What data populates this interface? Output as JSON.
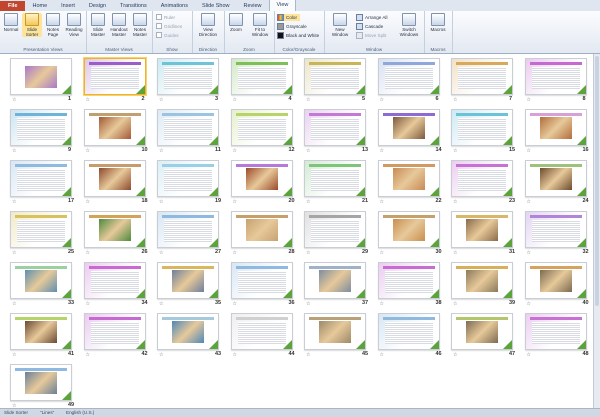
{
  "tabs": [
    "File",
    "Home",
    "Insert",
    "Design",
    "Transitions",
    "Animations",
    "Slide Show",
    "Review",
    "View"
  ],
  "ribbon": {
    "pres_views": {
      "label": "Presentation Views",
      "buttons": [
        "Normal",
        "Slide Sorter",
        "Notes Page",
        "Reading View"
      ]
    },
    "master_views": {
      "label": "Master Views",
      "buttons": [
        "Slide Master",
        "Handout Master",
        "Notes Master"
      ]
    },
    "show": {
      "label": "Show",
      "items": [
        "Ruler",
        "Gridlines",
        "Guides"
      ]
    },
    "direction": {
      "label": "Direction",
      "button": "View Direction"
    },
    "zoom": {
      "label": "Zoom",
      "buttons": [
        "Zoom",
        "Fit to Window"
      ]
    },
    "color": {
      "label": "Color/Grayscale",
      "items": [
        "Color",
        "Grayscale",
        "Black and White"
      ]
    },
    "window": {
      "label": "Window",
      "new_window": "New Window",
      "items": [
        "Arrange All",
        "Cascade",
        "Move Split"
      ],
      "switch": "Switch Windows"
    },
    "macros": {
      "label": "Macros",
      "button": "Macros"
    }
  },
  "slides": [
    {
      "n": "1",
      "band": "#ffffff",
      "kind": "photo",
      "photo": "#a978c9"
    },
    {
      "n": "2",
      "band": "#9b5ec9",
      "kind": "text",
      "sel": true
    },
    {
      "n": "3",
      "band": "#6fc3d8",
      "kind": "text"
    },
    {
      "n": "4",
      "band": "#7fbf5a",
      "kind": "text"
    },
    {
      "n": "5",
      "band": "#c7b55a",
      "kind": "text"
    },
    {
      "n": "6",
      "band": "#8fa8d9",
      "kind": "text"
    },
    {
      "n": "7",
      "band": "#d9a85b",
      "kind": "text"
    },
    {
      "n": "8",
      "band": "#c46ad1",
      "kind": "text"
    },
    {
      "n": "9",
      "band": "#6fb3d8",
      "kind": "text"
    },
    {
      "n": "10",
      "band": "#c0a070",
      "kind": "photo",
      "photo": "#a35a36"
    },
    {
      "n": "11",
      "band": "#9cc4e0",
      "kind": "text"
    },
    {
      "n": "12",
      "band": "#b7d36a",
      "kind": "text"
    },
    {
      "n": "13",
      "band": "#c27ad6",
      "kind": "text"
    },
    {
      "n": "14",
      "band": "#8d6ad6",
      "kind": "photo",
      "photo": "#7c5a3d"
    },
    {
      "n": "15",
      "band": "#6cc2d9",
      "kind": "text"
    },
    {
      "n": "16",
      "band": "#d7a0d8",
      "kind": "photo",
      "photo": "#b16d3c"
    },
    {
      "n": "17",
      "band": "#8fb9de",
      "kind": "text"
    },
    {
      "n": "18",
      "band": "#c89b6b",
      "kind": "photo",
      "photo": "#8d4a2f"
    },
    {
      "n": "19",
      "band": "#9ad0e5",
      "kind": "text"
    },
    {
      "n": "20",
      "band": "#b57ad7",
      "kind": "photo",
      "photo": "#9a4b2a"
    },
    {
      "n": "21",
      "band": "#7ec47a",
      "kind": "text"
    },
    {
      "n": "22",
      "band": "#d09a62",
      "kind": "photo",
      "photo": "#c98a55"
    },
    {
      "n": "23",
      "band": "#c771d4",
      "kind": "text"
    },
    {
      "n": "24",
      "band": "#9ec27c",
      "kind": "photo",
      "photo": "#6d4b2d"
    },
    {
      "n": "25",
      "band": "#d8c25e",
      "kind": "text"
    },
    {
      "n": "26",
      "band": "#d3a35a",
      "kind": "photo",
      "photo": "#4f8a3d"
    },
    {
      "n": "27",
      "band": "#8fb9de",
      "kind": "text"
    },
    {
      "n": "28",
      "band": "#c79f6a",
      "kind": "photo",
      "photo": "#c7a270"
    },
    {
      "n": "29",
      "band": "#a5a5a5",
      "kind": "text"
    },
    {
      "n": "30",
      "band": "#c3a26b",
      "kind": "photo",
      "photo": "#c88f4f"
    },
    {
      "n": "31",
      "band": "#d7b86b",
      "kind": "photo",
      "photo": "#8a6a4a"
    },
    {
      "n": "32",
      "band": "#b084d8",
      "kind": "text"
    },
    {
      "n": "33",
      "band": "#9bd0a0",
      "kind": "photo",
      "photo": "#5e8fb0"
    },
    {
      "n": "34",
      "band": "#c96ad3",
      "kind": "text"
    },
    {
      "n": "35",
      "band": "#d9b75e",
      "kind": "photo",
      "photo": "#6e7f9c"
    },
    {
      "n": "36",
      "band": "#8fb9de",
      "kind": "text"
    },
    {
      "n": "37",
      "band": "#9fb2c8",
      "kind": "photo",
      "photo": "#7d8d9e"
    },
    {
      "n": "38",
      "band": "#c66cd2",
      "kind": "text"
    },
    {
      "n": "39",
      "band": "#d8b05c",
      "kind": "photo",
      "photo": "#8a7a5a"
    },
    {
      "n": "40",
      "band": "#d6a35e",
      "kind": "photo",
      "photo": "#7b6a50"
    },
    {
      "n": "41",
      "band": "#b6d36a",
      "kind": "photo",
      "photo": "#6b4a32"
    },
    {
      "n": "42",
      "band": "#c46ad1",
      "kind": "text"
    },
    {
      "n": "43",
      "band": "#a7c9dd",
      "kind": "photo",
      "photo": "#4f87b8"
    },
    {
      "n": "44",
      "band": "#d0d0d0",
      "kind": "text"
    },
    {
      "n": "45",
      "band": "#b9a27a",
      "kind": "photo",
      "photo": "#9c8a6a"
    },
    {
      "n": "46",
      "band": "#8fb9de",
      "kind": "text"
    },
    {
      "n": "47",
      "band": "#b2c66c",
      "kind": "photo",
      "photo": "#7d6b52"
    },
    {
      "n": "48",
      "band": "#c771d4",
      "kind": "text"
    },
    {
      "n": "49",
      "band": "#8fb9de",
      "kind": "photo",
      "photo": "#6b7f98"
    }
  ],
  "status": {
    "view": "Slide Sorter",
    "theme": "\"Lines\"",
    "language": "English (U.S.)"
  },
  "colors": {
    "accent": "#5ba33a",
    "file_tab": "#c2452d",
    "selection": "#f0b22b"
  }
}
